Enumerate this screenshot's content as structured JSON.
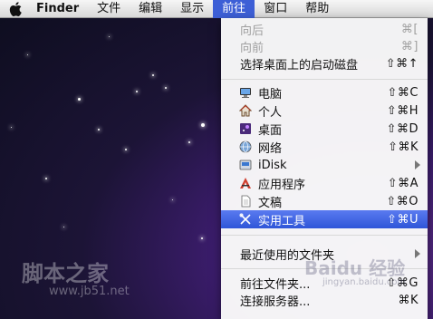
{
  "menubar": {
    "app_name": "Finder",
    "items": [
      "文件",
      "编辑",
      "显示",
      "前往",
      "窗口",
      "帮助"
    ]
  },
  "go_menu": {
    "items": [
      {
        "label": "向后",
        "shortcut": "⌘[",
        "disabled": true
      },
      {
        "label": "向前",
        "shortcut": "⌘]",
        "disabled": true
      },
      {
        "label": "选择桌面上的启动磁盘",
        "shortcut": "⇧⌘↑"
      },
      {
        "label": "电脑",
        "shortcut": "⇧⌘C",
        "icon": "computer-icon"
      },
      {
        "label": "个人",
        "shortcut": "⇧⌘H",
        "icon": "home-icon"
      },
      {
        "label": "桌面",
        "shortcut": "⇧⌘D",
        "icon": "desktop-icon"
      },
      {
        "label": "网络",
        "shortcut": "⇧⌘K",
        "icon": "network-globe-icon"
      },
      {
        "label": "iDisk",
        "icon": "idisk-icon",
        "submenu": true
      },
      {
        "label": "应用程序",
        "shortcut": "⇧⌘A",
        "icon": "applications-icon"
      },
      {
        "label": "文稿",
        "shortcut": "⇧⌘O",
        "icon": "documents-icon"
      },
      {
        "label": "实用工具",
        "shortcut": "⇧⌘U",
        "icon": "utilities-icon",
        "selected": true
      },
      {
        "label": "最近使用的文件夹",
        "submenu": true
      },
      {
        "label": "前往文件夹...",
        "shortcut": "⇧⌘G"
      },
      {
        "label": "连接服务器...",
        "shortcut": "⌘K"
      }
    ]
  },
  "watermarks": {
    "left_top": "脚本之家",
    "left_bottom": "www.jb51.net",
    "right_top": "Baidu 经验",
    "right_bottom": "jingyan.baidu.com"
  },
  "colors": {
    "highlight": "#3d5fd6"
  }
}
